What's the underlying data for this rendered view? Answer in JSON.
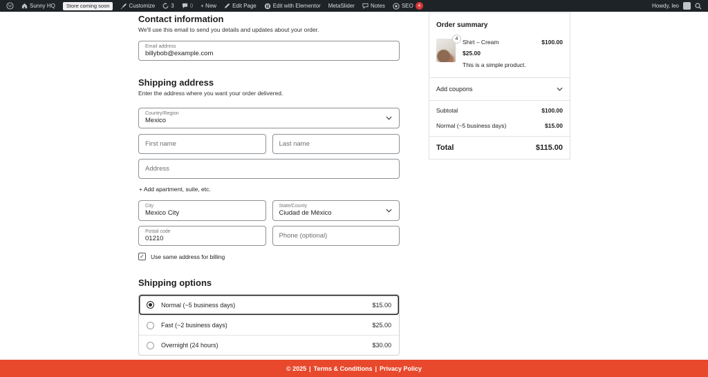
{
  "admin_bar": {
    "site_name": "Sunny HQ",
    "coming_soon_badge": "Store coming soon",
    "customize_label": "Customize",
    "updates_count": "3",
    "comments_count": "0",
    "new_label": "+ New",
    "edit_page_label": "Edit Page",
    "elementor_label": "Edit with Elementor",
    "metaslider_label": "MetaSlider",
    "notes_label": "Notes",
    "seo_label": "SEO",
    "seo_badge": "4",
    "howdy": "Howdy, leo"
  },
  "contact": {
    "heading": "Contact information",
    "description": "We'll use this email to send you details and updates about your order.",
    "email_label": "Email address",
    "email_value": "billybob@example.com"
  },
  "shipping_address": {
    "heading": "Shipping address",
    "description": "Enter the address where you want your order delivered.",
    "country_label": "Country/Region",
    "country_value": "Mexico",
    "first_name_placeholder": "First name",
    "last_name_placeholder": "Last name",
    "address_placeholder": "Address",
    "add_apartment_label": "+ Add apartment, suite, etc.",
    "city_label": "City",
    "city_value": "Mexico City",
    "state_label": "State/County",
    "state_value": "Ciudad de México",
    "postal_label": "Postal code",
    "postal_value": "01210",
    "phone_placeholder": "Phone (optional)",
    "billing_checkbox_label": "Use same address for billing",
    "billing_checkbox_checked": "✓"
  },
  "shipping_options": {
    "heading": "Shipping options",
    "options": [
      {
        "label": "Normal (~5 business days)",
        "price": "$15.00",
        "selected": true
      },
      {
        "label": "Fast (~2 business days)",
        "price": "$25.00",
        "selected": false
      },
      {
        "label": "Overnight (24 hours)",
        "price": "$30.00",
        "selected": false
      }
    ]
  },
  "order_summary": {
    "heading": "Order summary",
    "item": {
      "quantity": "4",
      "name": "Shirt – Cream",
      "line_total": "$100.00",
      "unit_price": "$25.00",
      "description": "This is a simple product."
    },
    "coupons_label": "Add coupons",
    "subtotal_label": "Subtotal",
    "subtotal_value": "$100.00",
    "shipping_label": "Normal (~5 business days)",
    "shipping_value": "$15.00",
    "total_label": "Total",
    "total_value": "$115.00"
  },
  "footer": {
    "copyright": "© 2025",
    "separator": "|",
    "terms_label": "Terms & Conditions",
    "privacy_label": "Privacy Policy"
  },
  "colors": {
    "admin_bar_bg": "#1d2327",
    "footer_bg": "#e8482c",
    "seo_badge_bg": "#d63638",
    "field_border": "#8c8f94",
    "selected_border": "#232323"
  }
}
